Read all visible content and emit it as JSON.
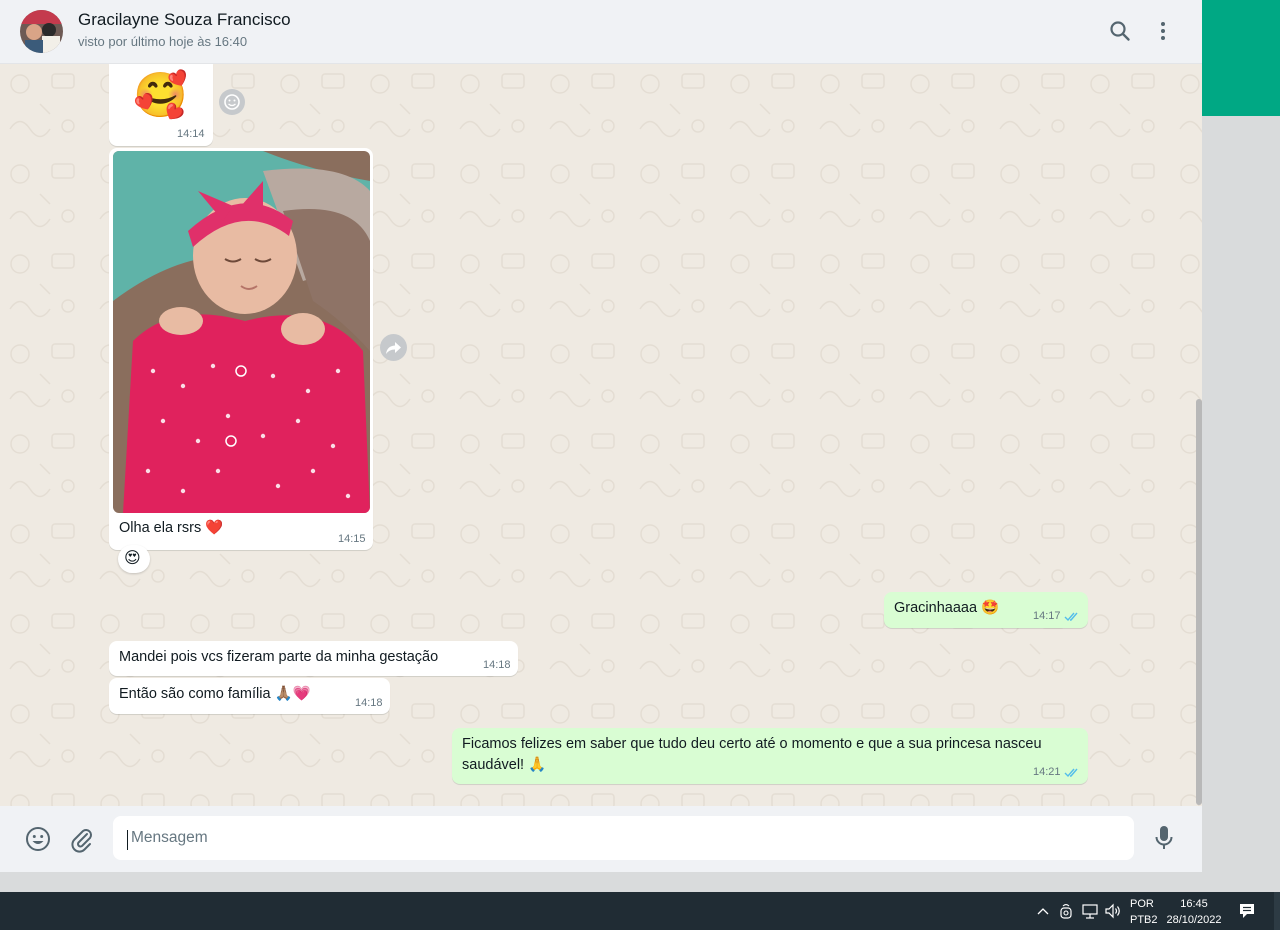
{
  "header": {
    "contact_name": "Gracilayne Souza Francisco",
    "status": "visto por último hoje às 16:40"
  },
  "messages": [
    {
      "type": "sticker",
      "direction": "in",
      "emoji": "🥰",
      "time": "14:14"
    },
    {
      "type": "image",
      "direction": "in",
      "caption": "Olha ela rsrs ❤️",
      "time": "14:15",
      "reaction": "😍"
    },
    {
      "type": "text",
      "direction": "out",
      "text": "Gracinhaaaa 🤩",
      "time": "14:17",
      "status": "read"
    },
    {
      "type": "text",
      "direction": "in",
      "text": "Mandei pois vcs fizeram parte da minha gestação",
      "time": "14:18"
    },
    {
      "type": "text",
      "direction": "in",
      "text": "Então são como família 🙏🏽💗",
      "time": "14:18"
    },
    {
      "type": "text",
      "direction": "out",
      "text": "Ficamos felizes em saber que tudo deu certo até o momento e que a sua princesa nasceu saudável! 🙏",
      "time": "14:21",
      "status": "read"
    }
  ],
  "composer": {
    "placeholder": "Mensagem"
  },
  "taskbar": {
    "lang_line1": "POR",
    "lang_line2": "PTB2",
    "time": "16:45",
    "date": "28/10/2022"
  },
  "icons": {
    "header": [
      "search-icon",
      "menu-icon"
    ],
    "composer": [
      "emoji-icon",
      "attach-icon",
      "mic-icon"
    ],
    "tray": [
      "chevron-up-icon",
      "meet-now-icon",
      "network-icon",
      "volume-icon",
      "notification-icon"
    ]
  },
  "colors": {
    "chat_bg": "#efeae2",
    "outgoing_bubble": "#d9fdd3",
    "incoming_bubble": "#ffffff",
    "accent": "#00a884",
    "read_ticks": "#53bdeb",
    "taskbar": "#202c34"
  }
}
